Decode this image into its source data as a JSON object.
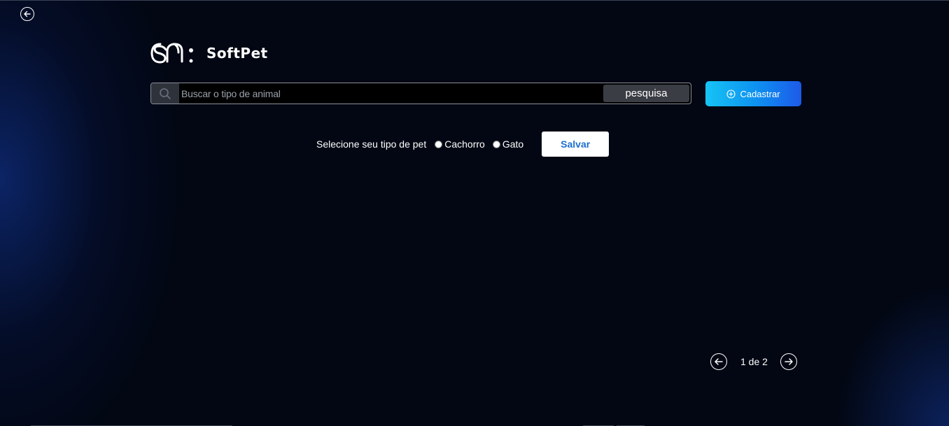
{
  "nav": {
    "back_icon": "arrow-left-circle-icon"
  },
  "brand": {
    "name": "SoftPet",
    "logo_icon": "softpet-logo-icon"
  },
  "search": {
    "placeholder": "Buscar o tipo de animal",
    "value": "",
    "icon": "search-icon",
    "button_label": "pesquisa"
  },
  "register": {
    "label": "Cadastrar",
    "icon": "plus-circle-icon"
  },
  "pet_form": {
    "label": "Selecione seu tipo de pet",
    "options": [
      {
        "label": "Cachorro",
        "checked": false
      },
      {
        "label": "Gato",
        "checked": false
      }
    ],
    "save_label": "Salvar"
  },
  "pagination": {
    "text": "1 de 2",
    "prev_icon": "arrow-left-circle-icon",
    "next_icon": "arrow-right-circle-icon"
  },
  "colors": {
    "background": "#020713",
    "accent_gradient_start": "#16c4f4",
    "accent_gradient_end": "#1d5ae8",
    "save_text": "#1d6fd0"
  }
}
